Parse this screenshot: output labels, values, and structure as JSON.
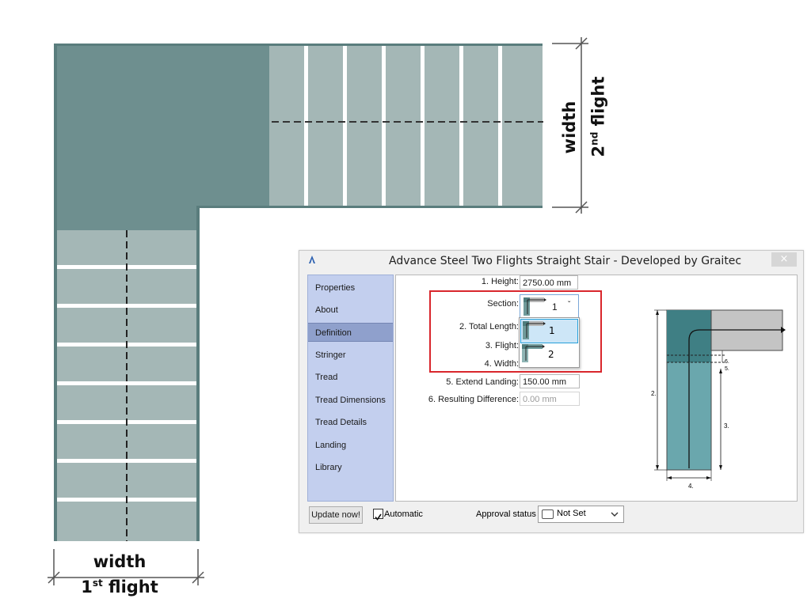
{
  "diagram": {
    "first_flight_label_line1": "width",
    "first_flight_label_line2_main": "1",
    "first_flight_label_line2_sup": "st",
    "first_flight_label_line2_end": " flight",
    "second_flight_label_line1": "width",
    "second_flight_label_line2_main": "2",
    "second_flight_label_line2_sup": "nd",
    "second_flight_label_line2_end": " flight"
  },
  "dialog": {
    "title": "Advance Steel   Two Flights Straight Stair - Developed by Graitec",
    "close_glyph": "×",
    "sidebar": [
      {
        "label": "Properties"
      },
      {
        "label": "About"
      },
      {
        "label": "Definition"
      },
      {
        "label": "Stringer"
      },
      {
        "label": "Tread"
      },
      {
        "label": "Tread Dimensions"
      },
      {
        "label": "Tread Details"
      },
      {
        "label": "Landing"
      },
      {
        "label": "Library"
      }
    ],
    "active_item": "Definition",
    "fields": {
      "height_label": "1. Height:",
      "height_value": "2750.00 mm",
      "section_label": "Section:",
      "section_value": "1",
      "total_length_label": "2. Total Length:",
      "flight_label": "3. Flight:",
      "width_label": "4. Width:",
      "extend_landing_label": "5. Extend Landing:",
      "extend_landing_value": "150.00 mm",
      "resulting_difference_label": "6. Resulting Difference:",
      "resulting_difference_value": "0.00 mm"
    },
    "section_options": [
      "1",
      "2"
    ],
    "preview_labels": {
      "p2": "2.",
      "p3": "3.",
      "p4": "4.",
      "p5": "5.",
      "p6": "6."
    },
    "bottom": {
      "update_button": "Update now!",
      "automatic_label": "Automatic",
      "automatic_checked": true,
      "approval_label": "Approval status",
      "approval_value": "Not Set"
    },
    "colors": {
      "highlight_box": "#d9262c",
      "sidebar_bg": "#c3cfee",
      "stair_dark": "#6e8f8f",
      "stair_light": "#a4b7b6"
    }
  }
}
